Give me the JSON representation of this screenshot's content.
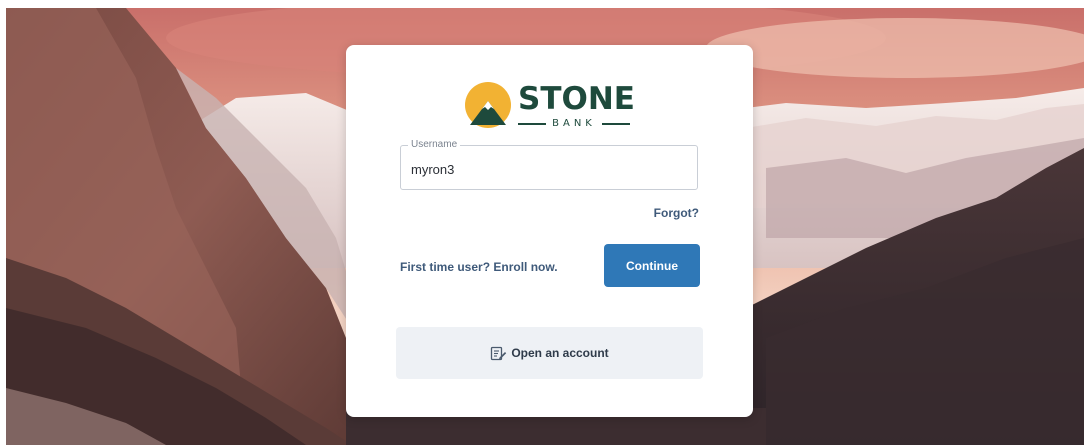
{
  "brand": {
    "name": "STONE",
    "sub": "BANK"
  },
  "login": {
    "username_label": "Username",
    "username_value": "myron3",
    "forgot_label": "Forgot?",
    "enroll_label": "First time user? Enroll now.",
    "continue_label": "Continue",
    "open_account_label": "Open an account"
  },
  "colors": {
    "brand_green": "#1e4a3c",
    "brand_gold": "#f2b233",
    "primary_button": "#2f78b7"
  },
  "icons": {
    "open_account": "edit-document-icon",
    "logo": "mountain-sun-icon"
  }
}
